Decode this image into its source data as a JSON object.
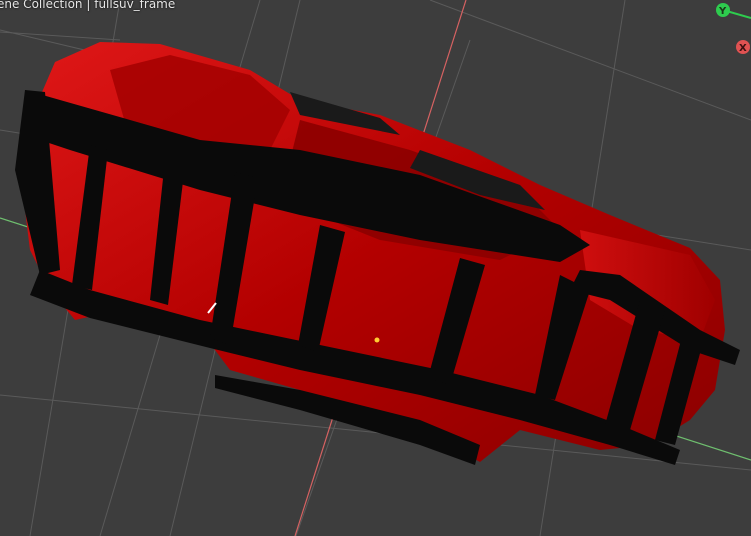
{
  "viewport": {
    "breadcrumb": "ene Collection | fullsuv_frame",
    "background_color": "#3d3d3d",
    "grid_line_color": "#595959"
  },
  "axes": {
    "x_axis_color": "#d66262",
    "y_axis_color": "#6fbf6f"
  },
  "gizmo": {
    "y_label": "Y",
    "y_color": "#2ecc4e",
    "x_label": "X",
    "x_color": "#e05252"
  },
  "object": {
    "name": "fullsuv_frame",
    "body_color": "#c40000",
    "frame_color": "#0a0a0a",
    "origin_color": "#ffcc33"
  }
}
